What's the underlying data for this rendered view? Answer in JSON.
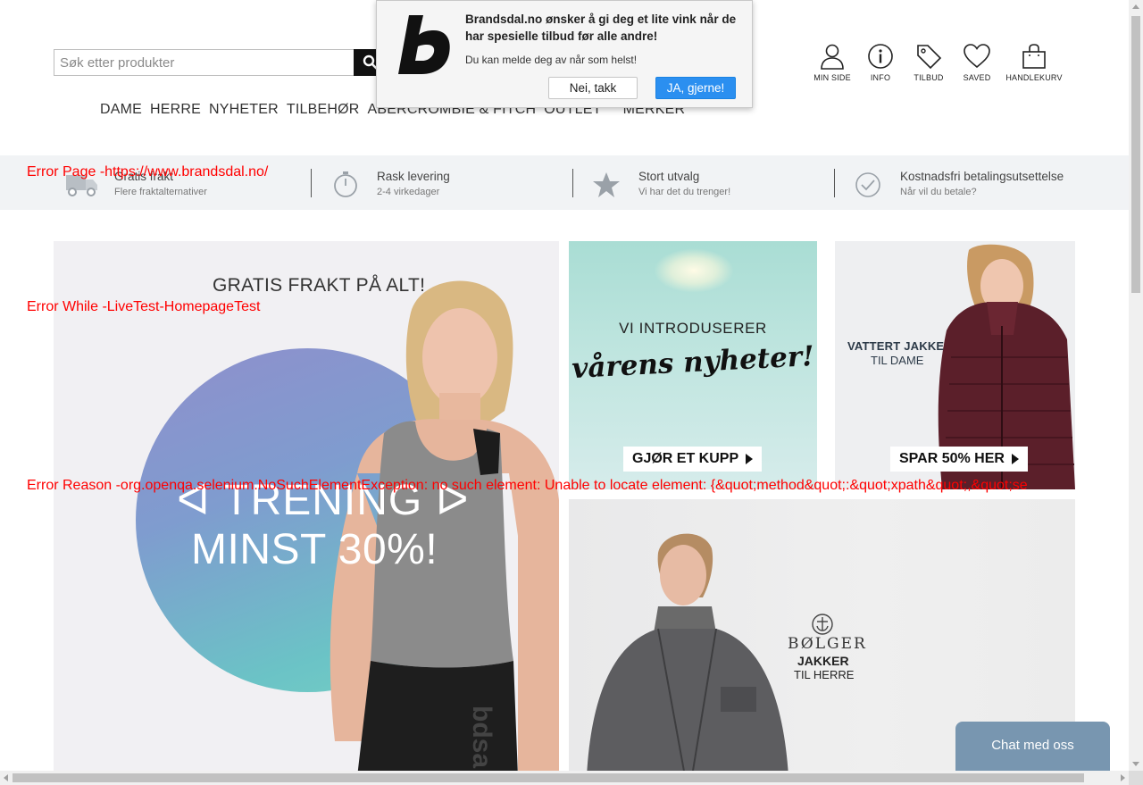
{
  "search": {
    "placeholder": "Søk etter produkter"
  },
  "nav": {
    "items": [
      "DAME",
      "HERRE",
      "NYHETER",
      "TILBEHØR",
      "ABERCROMBIE & FITCH",
      "OUTLET",
      "MERKER"
    ]
  },
  "user_menu": {
    "items": [
      {
        "label": "MIN SIDE",
        "icon": "user-icon"
      },
      {
        "label": "INFO",
        "icon": "info-icon"
      },
      {
        "label": "TILBUD",
        "icon": "tag-icon"
      },
      {
        "label": "SAVED",
        "icon": "heart-icon"
      },
      {
        "label": "HANDLEKURV",
        "icon": "bag-icon"
      }
    ]
  },
  "popup": {
    "title": "Brandsdal.no ønsker å gi deg et lite vink når de har spesielle tilbud før alle andre!",
    "subtitle": "Du kan melde deg av når som helst!",
    "decline": "Nei, takk",
    "accept": "JA, gjerne!"
  },
  "usp": [
    {
      "title": "Gratis frakt",
      "sub": "Flere fraktalternativer",
      "icon": "truck-icon"
    },
    {
      "title": "Rask levering",
      "sub": "2-4 virkedager",
      "icon": "stopwatch-icon"
    },
    {
      "title": "Stort utvalg",
      "sub": "Vi har det du trenger!",
      "icon": "star-icon"
    },
    {
      "title": "Kostnadsfri betalingsutsettelse",
      "sub": "Når vil du betale?",
      "icon": "check-circle-icon"
    }
  ],
  "banners": {
    "main": {
      "headline": "GRATIS FRAKT PÅ ALT!",
      "line1": "TRENING",
      "line2": "MINST 30%!"
    },
    "spring": {
      "line1": "VI INTRODUSERER",
      "line2": "vårens nyheter!",
      "cta": "GJØR ET KUPP"
    },
    "jacket": {
      "line1": "VATTERT JAKKE",
      "line2": "TIL DAME",
      "cta": "SPAR 50% HER"
    },
    "bolger": {
      "brand": "BØLGER",
      "line1": "JAKKER",
      "line2": "TIL HERRE"
    }
  },
  "errors": {
    "page": "Error Page -https://www.brandsdal.no/",
    "while": "Error While -LiveTest-HomepageTest",
    "reason": "Error Reason -org.openqa.selenium.NoSuchElementException: no such element: Unable to locate element: {&quot;method&quot;:&quot;xpath&quot;,&quot;se"
  },
  "chat": {
    "label": "Chat med oss"
  },
  "colors": {
    "popup_accept": "#2b8ff0",
    "chat": "#7896b0",
    "error": "#ff0000",
    "usp_bar": "#f1f3f5"
  }
}
